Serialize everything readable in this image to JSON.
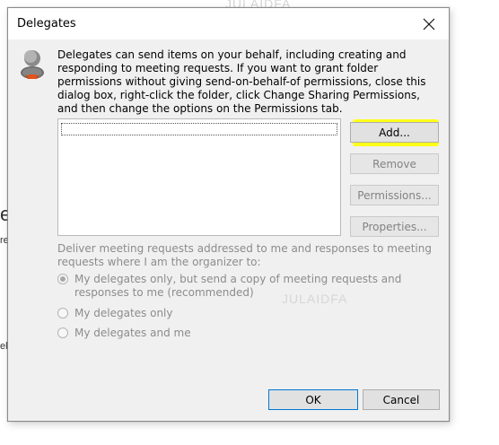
{
  "dialog": {
    "title": "Delegates",
    "description": "Delegates can send items on your behalf, including creating and responding to meeting requests. If you want to grant folder permissions without giving send-on-behalf-of permissions, close this dialog box, right-click the folder, click Change Sharing Permissions, and then change the options on the Permissions tab.",
    "delegates_list": [],
    "buttons": {
      "add": "Add...",
      "remove": "Remove",
      "permissions": "Permissions...",
      "properties": "Properties..."
    },
    "deliver_text": "Deliver meeting requests addressed to me and responses to meeting requests where I am the organizer to:",
    "options": [
      {
        "label": "My delegates only, but send a copy of meeting requests and responses to me (recommended)",
        "selected": true
      },
      {
        "label": "My delegates only",
        "selected": false
      },
      {
        "label": "My delegates and me",
        "selected": false
      }
    ],
    "ok": "OK",
    "cancel": "Cancel"
  },
  "watermark": "JULAIDFA",
  "colors": {
    "highlight": "#ffff18",
    "accent_border": "#0078d7",
    "disabled_text": "#8c8c8c"
  }
}
